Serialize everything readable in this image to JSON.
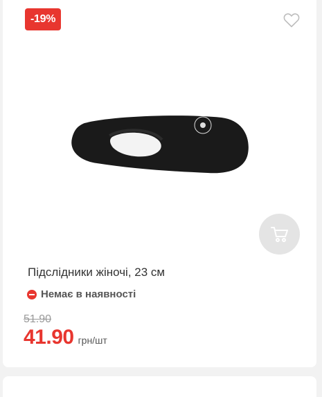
{
  "product": {
    "discount_badge": "-19%",
    "title": "Підслідники жіночі, 23 см",
    "availability": "Немає в наявності",
    "old_price": "51.90",
    "price": "41.90",
    "unit": "грн/шт"
  },
  "colors": {
    "accent": "#e8362f",
    "cart_button_bg": "#e4e4e4",
    "card_bg": "#ffffff",
    "page_bg": "#f2f2f2"
  },
  "icons": {
    "favorite": "heart-outline-icon",
    "cart": "cart-icon",
    "availability": "minus-circle-icon"
  }
}
